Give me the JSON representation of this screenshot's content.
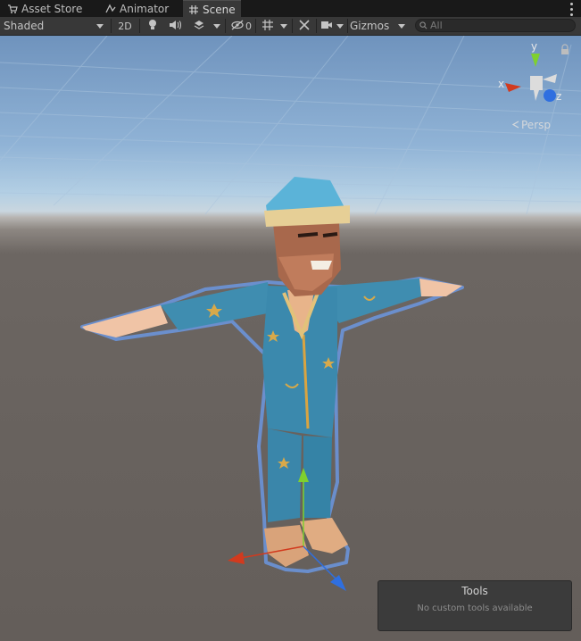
{
  "tabs": [
    {
      "label": "Asset Store",
      "icon": "shopping-cart-icon",
      "active": false
    },
    {
      "label": "Animator",
      "icon": "animator-icon",
      "active": false
    },
    {
      "label": "Scene",
      "icon": "scene-grid-icon",
      "active": true
    }
  ],
  "toolbar": {
    "draw_mode": "Shaded",
    "mode_2d": "2D",
    "hidden_count": "0",
    "gizmos_label": "Gizmos",
    "search_placeholder": "All"
  },
  "scene": {
    "orientation_gizmo": {
      "x_label": "x",
      "y_label": "y",
      "z_label": "z"
    },
    "projection_label": "Persp"
  },
  "tools_overlay": {
    "title": "Tools",
    "message": "No custom tools available"
  },
  "colors": {
    "accent_x": "#d23a1e",
    "accent_y": "#7fd02f",
    "accent_z": "#2f6fe0",
    "selection_outline": "#5a8ee6"
  }
}
